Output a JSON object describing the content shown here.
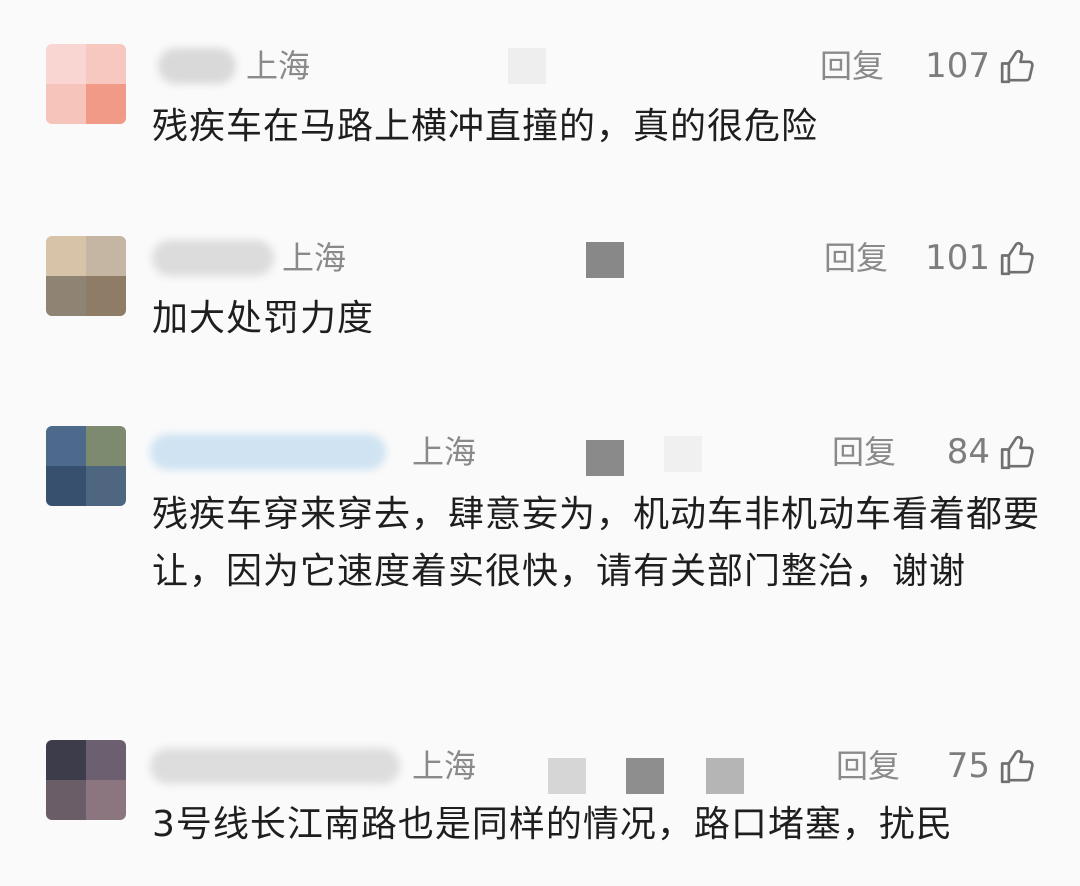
{
  "comments": [
    {
      "location": "上海",
      "reply_label": "回复",
      "likes": "107",
      "text": "残疾车在马路上横冲直撞的，真的很危险"
    },
    {
      "location": "上海",
      "reply_label": "回复",
      "likes": "101",
      "text": "加大处罚力度"
    },
    {
      "location": "上海",
      "reply_label": "回复",
      "likes": "84",
      "text": "残疾车穿来穿去，肆意妄为，机动车非机动车看着都要让，因为它速度着实很快，请有关部门整治，谢谢"
    },
    {
      "location": "上海",
      "reply_label": "回复",
      "likes": "75",
      "text": "3号线长江南路也是同样的情况，路口堵塞，扰民"
    }
  ],
  "icons": {
    "like": "thumbs-up-icon",
    "avatar": "avatar"
  },
  "colors": {
    "text": "#1e1e1e",
    "meta": "#8a8a8a",
    "background": "#fafafa"
  }
}
